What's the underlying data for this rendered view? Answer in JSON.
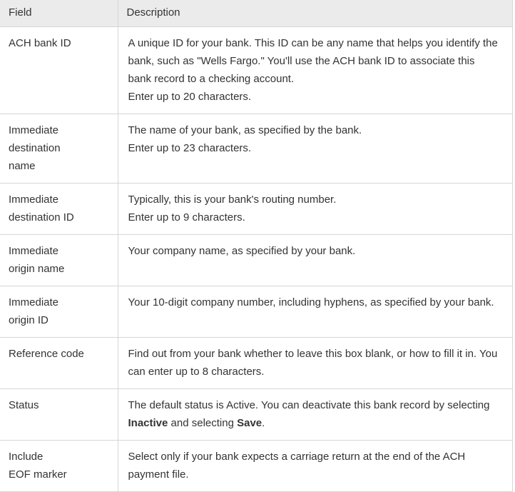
{
  "table": {
    "columns": [
      {
        "key": "field",
        "label": "Field"
      },
      {
        "key": "description",
        "label": "Description"
      }
    ],
    "accent_border_color": "#d6d6d6",
    "header_background": "#ebebeb",
    "text_color": "#333333",
    "rows": [
      {
        "field_lines": [
          "ACH bank ID"
        ],
        "paragraphs": [
          "A unique ID for your bank. This ID can be any name that helps you identify the bank, such as \"Wells Fargo.\" You'll use the ACH bank ID to associate this bank record to a checking account.",
          "Enter up to 20 characters."
        ]
      },
      {
        "field_lines": [
          "Immediate",
          "destination",
          "name"
        ],
        "paragraphs": [
          "The name of your bank, as specified by the bank.",
          "Enter up to 23 characters."
        ]
      },
      {
        "field_lines": [
          "Immediate",
          "destination ID"
        ],
        "paragraphs": [
          "Typically, this is your bank's routing number.",
          "Enter up to 9 characters."
        ]
      },
      {
        "field_lines": [
          "Immediate",
          "origin name"
        ],
        "paragraphs": [
          "Your company name, as specified by your bank."
        ]
      },
      {
        "field_lines": [
          "Immediate",
          "origin ID"
        ],
        "paragraphs": [
          "Your 10-digit company number, including hyphens, as specified by your bank."
        ]
      },
      {
        "field_lines": [
          "Reference code"
        ],
        "paragraphs": [
          "Find out from your bank whether to leave this box blank, or how to fill it in. You can enter up to 8 characters."
        ]
      },
      {
        "field_lines": [
          "Status"
        ],
        "rich_paragraphs": [
          [
            {
              "text": "The default status is Active. You can deactivate this bank record by selecting ",
              "bold": false
            },
            {
              "text": "Inactive",
              "bold": true
            },
            {
              "text": " and selecting ",
              "bold": false
            },
            {
              "text": "Save",
              "bold": true
            },
            {
              "text": ".",
              "bold": false
            }
          ]
        ]
      },
      {
        "field_lines": [
          "Include",
          "EOF marker"
        ],
        "paragraphs": [
          "Select only if your bank expects a carriage return at the end of the ACH payment file."
        ]
      }
    ]
  }
}
